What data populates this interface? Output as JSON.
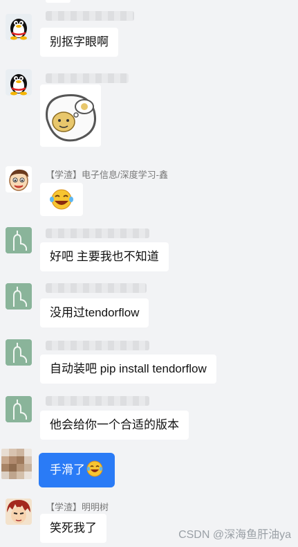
{
  "messages": [
    {
      "id": "m1",
      "avatar": "qq-penguin-avatar",
      "sender": "",
      "text": "别抠字眼啊"
    },
    {
      "id": "m2",
      "avatar": "qq-penguin-avatar",
      "sender": "",
      "sticker": "bun-face-thought-sticker"
    },
    {
      "id": "m3",
      "avatar": "cartoon-boy-avatar",
      "sender": "【学渣】电子信息/深度学习-鑫",
      "emoji": "laughing-face-emoji"
    },
    {
      "id": "m4",
      "avatar": "finger-sketch-avatar",
      "sender": "",
      "text": "好吧 主要我也不知道"
    },
    {
      "id": "m5",
      "avatar": "finger-sketch-avatar",
      "sender": "",
      "text": "没用过tendorflow"
    },
    {
      "id": "m6",
      "avatar": "finger-sketch-avatar",
      "sender": "",
      "text": "自动装吧 pip install tendorflow"
    },
    {
      "id": "m7",
      "avatar": "finger-sketch-avatar",
      "sender": "",
      "text": "他会给你一个合适的版本"
    },
    {
      "id": "m8",
      "avatar": "mosaic-avatar",
      "sender": "",
      "text": "手滑了",
      "emoji": "laughing-face-emoji",
      "accent": "#2a7bf6"
    },
    {
      "id": "m9",
      "avatar": "anime-avatar",
      "sender": "【学渣】明明树",
      "text": "笑死我了"
    }
  ],
  "watermark": "CSDN @深海鱼肝油ya",
  "colors": {
    "background": "#f2f3f5",
    "bubble": "#ffffff",
    "self_bubble": "#2a7bf6",
    "sender_text": "#777777"
  }
}
